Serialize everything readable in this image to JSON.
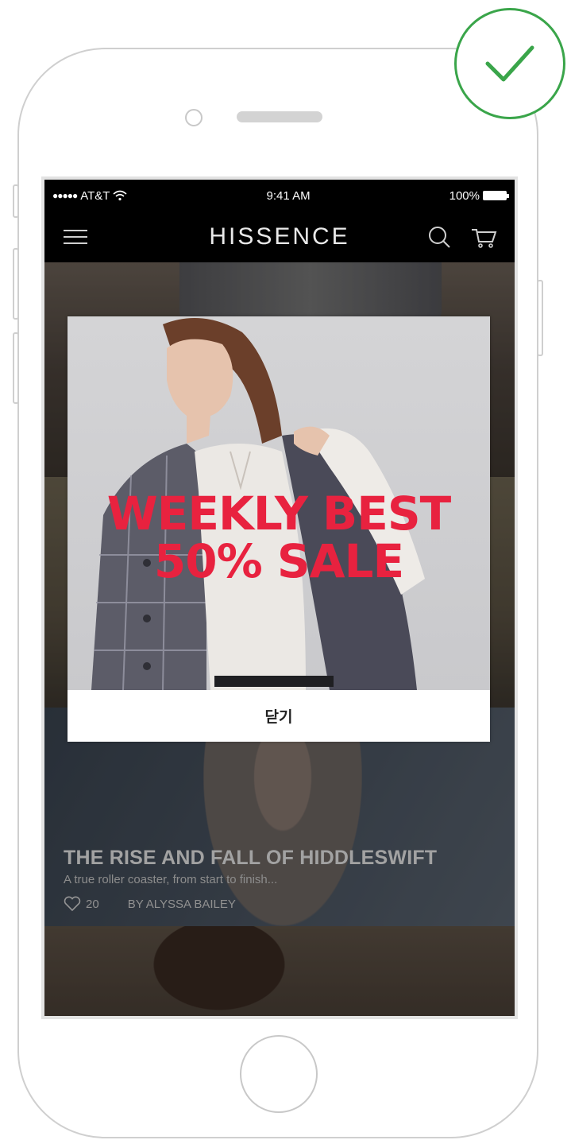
{
  "status_bar": {
    "carrier": "AT&T",
    "signal_dots": "●●●●●",
    "time": "9:41 AM",
    "battery": "100%"
  },
  "nav": {
    "brand": "HISSENCE",
    "icons": [
      "menu-icon",
      "search-icon",
      "cart-icon"
    ]
  },
  "popup": {
    "headline_line1": "WEEKLY BEST",
    "headline_line2": "50% SALE",
    "close_label": "닫기",
    "headline_color": "#e8223f"
  },
  "feed": {
    "article": {
      "title": "THE RISE AND FALL OF HIDDLESWIFT",
      "subtitle": "A true roller coaster, from start to finish...",
      "likes": "20",
      "author": "BY ALYSSA BAILEY"
    }
  },
  "badge": {
    "icon": "check-icon",
    "color": "#3aa54a"
  }
}
